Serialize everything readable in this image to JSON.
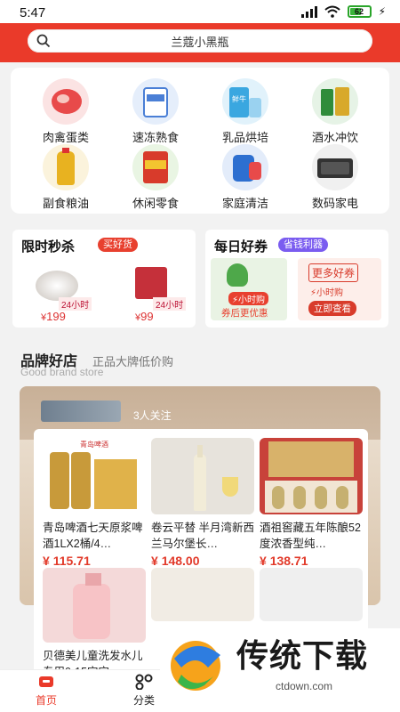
{
  "status": {
    "time": "5:47",
    "battery": "62"
  },
  "search": {
    "placeholder": "兰蔻小黑瓶"
  },
  "categories": [
    {
      "label": "肉禽蛋类",
      "icon": "meat-icon",
      "color": "#e84a4a"
    },
    {
      "label": "速冻熟食",
      "icon": "frozen-food-icon",
      "color": "#4a7fd6"
    },
    {
      "label": "乳品烘培",
      "icon": "dairy-icon",
      "color": "#3aa7e0"
    },
    {
      "label": "酒水冲饮",
      "icon": "drinks-icon",
      "color": "#2f8c3a"
    },
    {
      "label": "副食粮油",
      "icon": "oil-icon",
      "color": "#e8b220"
    },
    {
      "label": "休闲零食",
      "icon": "snack-icon",
      "color": "#d83b2b"
    },
    {
      "label": "家庭清洁",
      "icon": "cleaning-icon",
      "color": "#2d6fd0"
    },
    {
      "label": "数码家电",
      "icon": "speaker-icon",
      "color": "#333333"
    }
  ],
  "flash_sale": {
    "title": "限时秒杀",
    "tag": "买好货",
    "items": [
      {
        "badge": "24小时",
        "price": "199"
      },
      {
        "badge": "24小时",
        "price": "99"
      }
    ]
  },
  "coupons": {
    "title": "每日好券",
    "tag": "省钱利器",
    "left_badge": "小时购",
    "left_caption": "券后更优惠",
    "right_title": "更多好券",
    "right_badge": "小时购",
    "right_button": "立即查看"
  },
  "brand": {
    "title": "品牌好店",
    "subtitle": "正品大牌低价购",
    "english": "Good brand store",
    "followers": "3人关注",
    "products": [
      {
        "name": "青岛啤酒七天原浆啤酒1LX2桶/4…",
        "price": "115.71",
        "img": "beer-image"
      },
      {
        "name": "卷云平替 半月湾新西兰马尔堡长…",
        "price": "148.00",
        "img": "wine-image"
      },
      {
        "name": "酒祖窖藏五年陈酿52度浓香型纯…",
        "price": "138.71",
        "img": "liquor-image"
      },
      {
        "name": "贝德美儿童洗发水儿专用0-15宝宝…",
        "price": "",
        "img": "shampoo-image"
      }
    ]
  },
  "nav": {
    "home": "首页",
    "category": "分类"
  },
  "watermark": {
    "text": "传统下载",
    "url": "ctdown.com"
  },
  "colors": {
    "accent": "#ea3a2a",
    "price": "#e23a2a"
  }
}
